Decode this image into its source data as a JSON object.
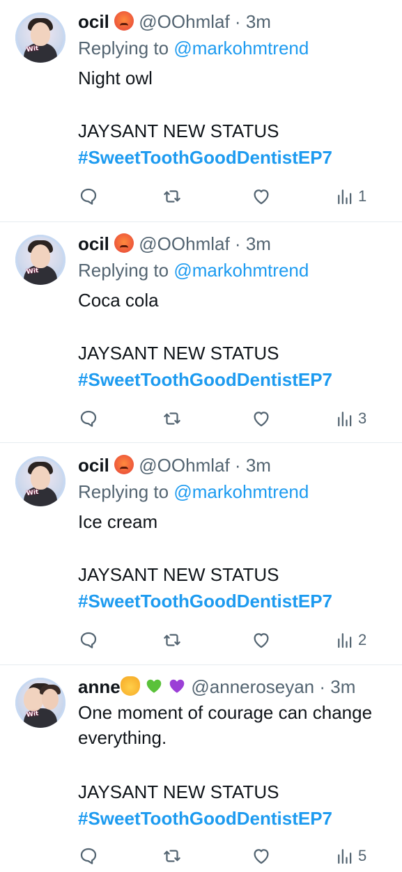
{
  "tweets": [
    {
      "name": "ocil",
      "name_emoji": "angry-face-emoji",
      "handle": "@OOhmlaf",
      "dot": "·",
      "time": "3m",
      "reply_prefix": "Replying to",
      "reply_mention": "@markohmtrend",
      "body_lines": [
        "Night owl",
        "",
        "JAYSANT NEW STATUS"
      ],
      "hashtag": "#SweetToothGoodDentistEP7",
      "views": "1"
    },
    {
      "name": "ocil",
      "name_emoji": "angry-face-emoji",
      "handle": "@OOhmlaf",
      "dot": "·",
      "time": "3m",
      "reply_prefix": "Replying to",
      "reply_mention": "@markohmtrend",
      "body_lines": [
        "Coca cola",
        "",
        "JAYSANT NEW STATUS"
      ],
      "hashtag": "#SweetToothGoodDentistEP7",
      "views": "3"
    },
    {
      "name": "ocil",
      "name_emoji": "angry-face-emoji",
      "handle": "@OOhmlaf",
      "dot": "·",
      "time": "3m",
      "reply_prefix": "Replying to",
      "reply_mention": "@markohmtrend",
      "body_lines": [
        "Ice cream",
        "",
        "JAYSANT NEW STATUS"
      ],
      "hashtag": "#SweetToothGoodDentistEP7",
      "views": "2"
    },
    {
      "name": "anne",
      "name_emoji": "cat-face-green-heart-purple-heart-emoji",
      "handle": "@anneroseyan",
      "dot": "·",
      "time": "3m",
      "body_lines": [
        "One moment of courage can change",
        "everything.",
        "",
        "JAYSANT NEW STATUS"
      ],
      "hashtag": "#SweetToothGoodDentistEP7",
      "views": "5"
    }
  ],
  "icons": {
    "reply": "reply-bubble-icon",
    "retweet": "retweet-icon",
    "like": "heart-icon",
    "views": "views-bar-chart-icon"
  },
  "colors": {
    "link": "#1d9bf0",
    "muted": "#536471",
    "text": "#0f1419",
    "divider": "#e6ecf0"
  }
}
